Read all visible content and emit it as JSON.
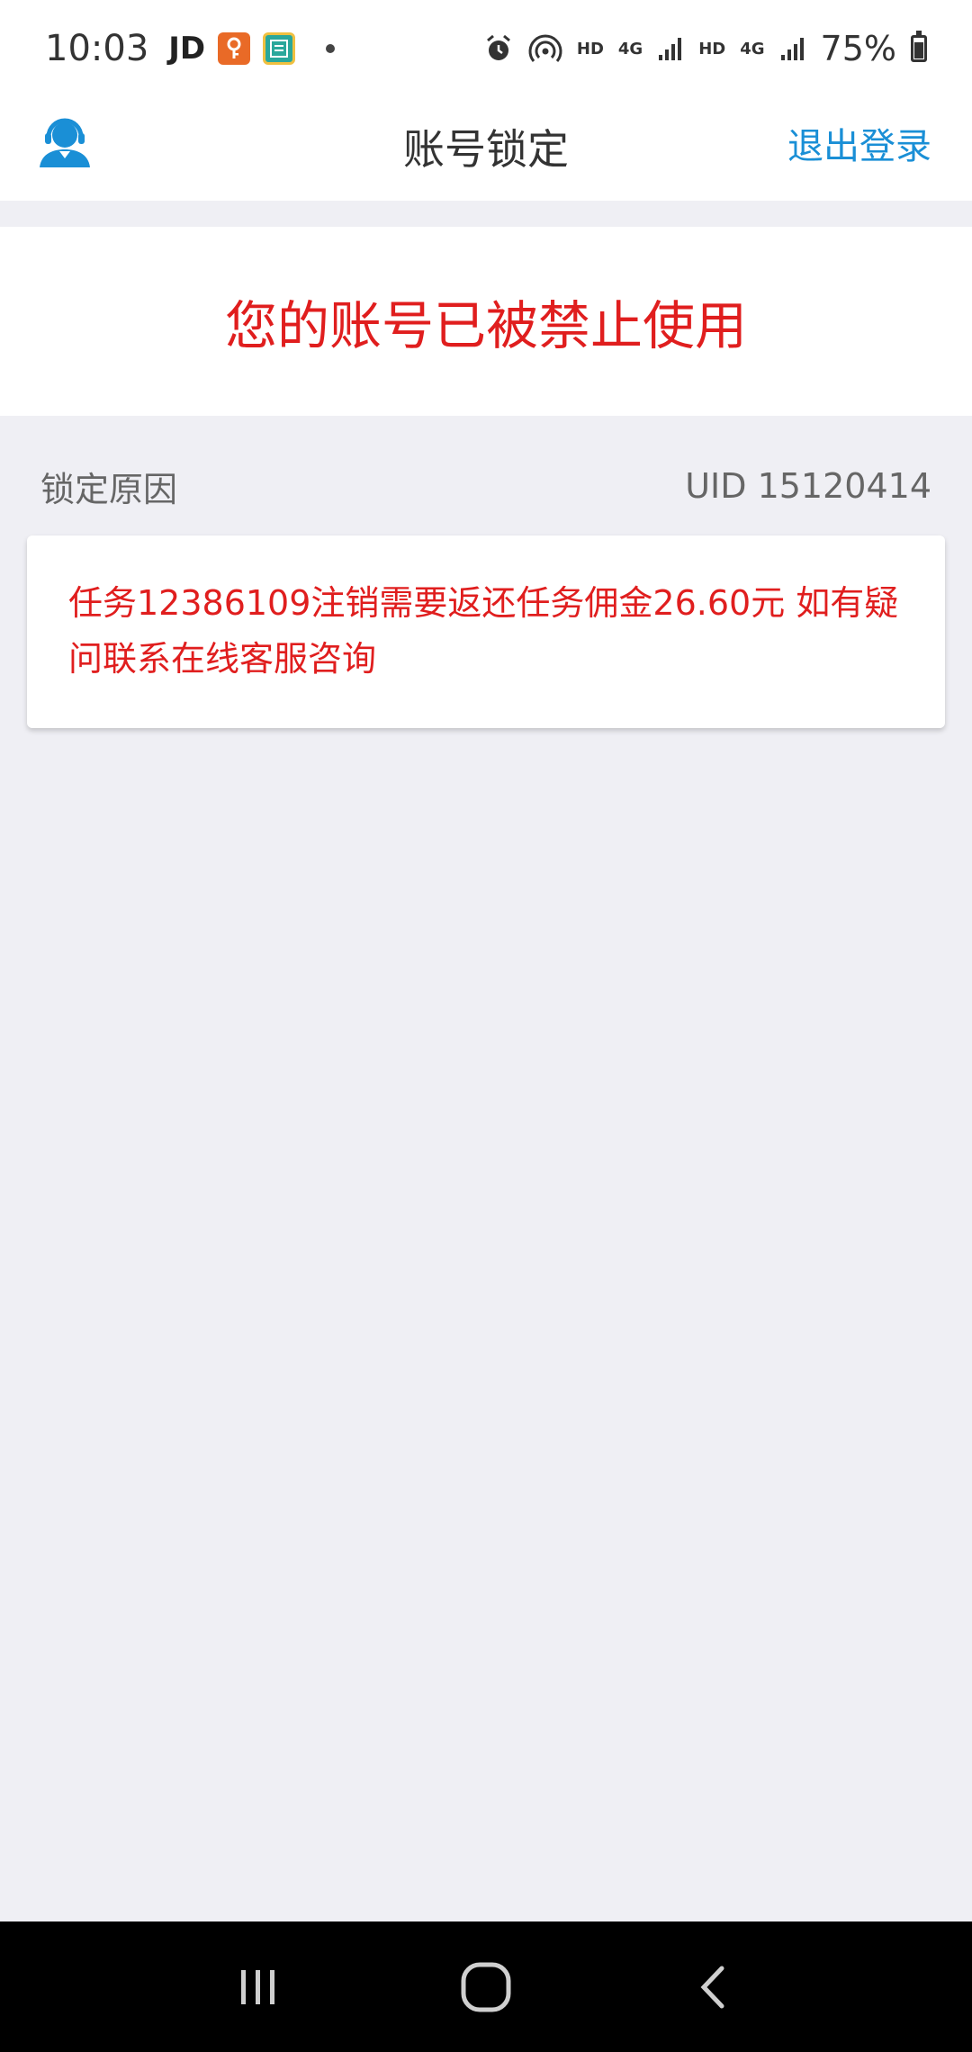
{
  "status_bar": {
    "time": "10:03",
    "carrier_label": "JD",
    "hd_label_1": "HD",
    "net_label_1": "4G",
    "hd_label_2": "HD",
    "net_label_2": "4G",
    "battery_percent": "75%",
    "battery_level": 0.75
  },
  "header": {
    "title": "账号锁定",
    "logout_label": "退出登录",
    "accent_color": "#1a8fd6"
  },
  "banner": {
    "message": "您的账号已被禁止使用",
    "color": "#e01e1e"
  },
  "reason": {
    "label": "锁定原因",
    "uid": "UID 15120414",
    "text": "任务12386109注销需要返还任务佣金26.60元 如有疑问联系在线客服咨询"
  },
  "icons": {
    "avatar": "customer-service-icon",
    "nav_recent": "recent-apps-icon",
    "nav_home": "home-icon",
    "nav_back": "back-icon"
  }
}
